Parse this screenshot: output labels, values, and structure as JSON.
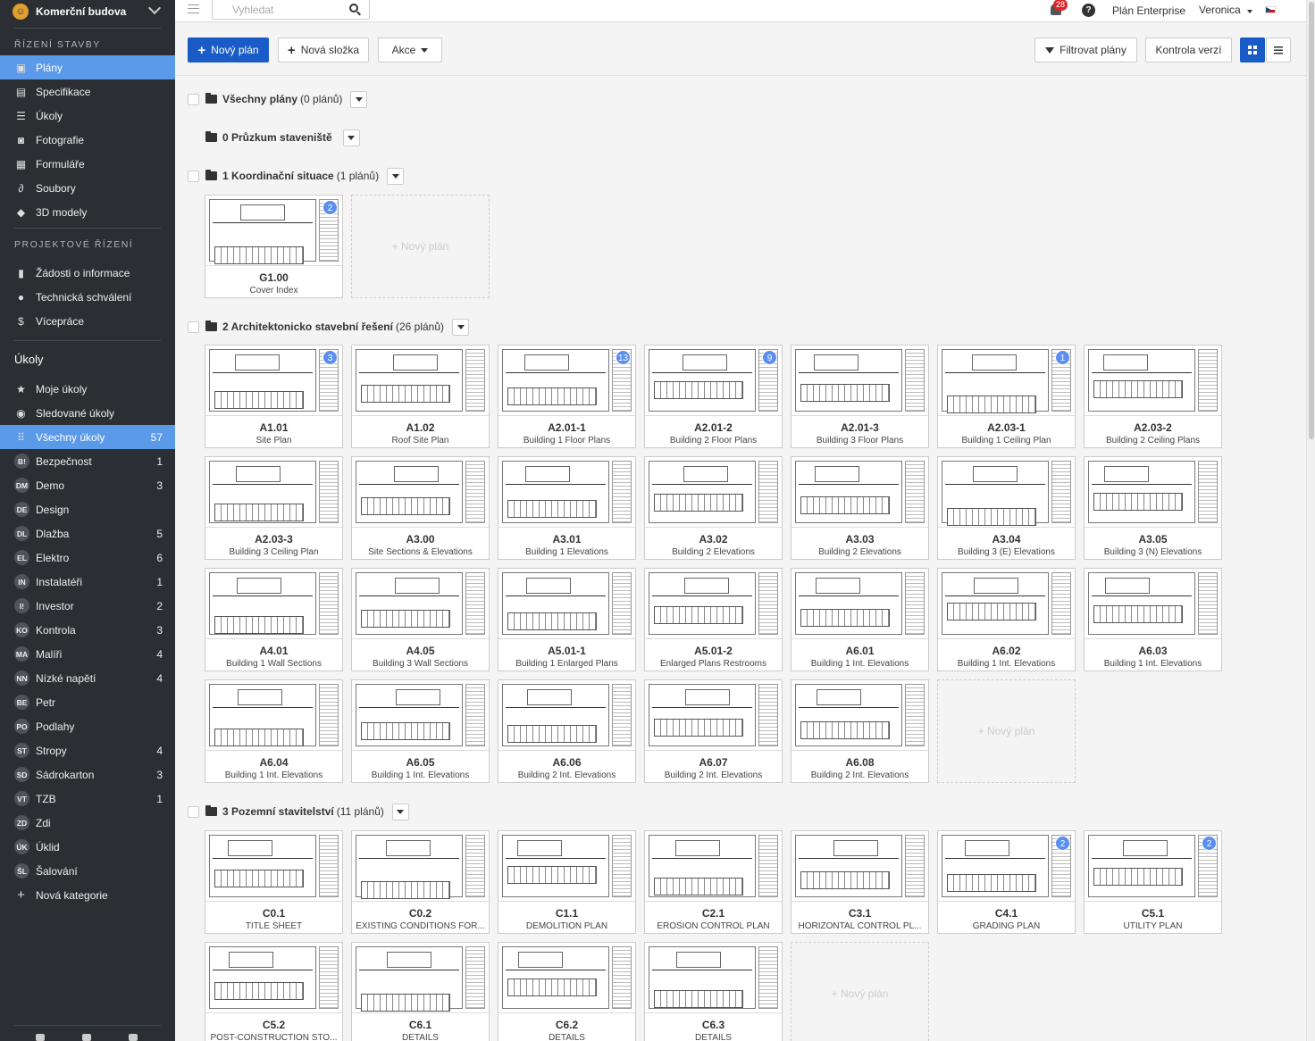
{
  "sidebar": {
    "project": "Komerční budova",
    "section1": "ŘÍZENÍ STAVBY",
    "nav1": [
      {
        "label": "Plány",
        "icon": "plans-icon"
      },
      {
        "label": "Specifikace",
        "icon": "spec-icon"
      },
      {
        "label": "Úkoly",
        "icon": "tasks-icon"
      },
      {
        "label": "Fotografie",
        "icon": "camera-icon"
      },
      {
        "label": "Formuláře",
        "icon": "forms-icon"
      },
      {
        "label": "Soubory",
        "icon": "paperclip-icon"
      },
      {
        "label": "3D modely",
        "icon": "cube-icon"
      }
    ],
    "section2": "PROJEKTOVÉ ŘÍZENÍ",
    "nav2": [
      {
        "label": "Žádosti o informace",
        "icon": "rfi-icon"
      },
      {
        "label": "Technická schválení",
        "icon": "person-icon"
      },
      {
        "label": "Vícepráce",
        "icon": "dollar-doc-icon"
      }
    ],
    "tasks_heading": "Úkoly",
    "tasks_nav": [
      {
        "label": "Moje úkoly",
        "icon": "star-icon",
        "count": ""
      },
      {
        "label": "Sledované úkoly",
        "icon": "eye-icon",
        "count": ""
      },
      {
        "label": "Všechny úkoly",
        "icon": "grid-icon",
        "count": "57"
      }
    ],
    "categories": [
      {
        "abbr": "B!",
        "label": "Bezpečnost",
        "count": "1"
      },
      {
        "abbr": "DM",
        "label": "Demo",
        "count": "3"
      },
      {
        "abbr": "DE",
        "label": "Design",
        "count": ""
      },
      {
        "abbr": "DL",
        "label": "Dlažba",
        "count": "5"
      },
      {
        "abbr": "EL",
        "label": "Elektro",
        "count": "6"
      },
      {
        "abbr": "IN",
        "label": "Instalatéři",
        "count": "1"
      },
      {
        "abbr": "I!",
        "label": "Investor",
        "count": "2"
      },
      {
        "abbr": "KO",
        "label": "Kontrola",
        "count": "3"
      },
      {
        "abbr": "MA",
        "label": "Malíři",
        "count": "4"
      },
      {
        "abbr": "NN",
        "label": "Nízké napětí",
        "count": "4"
      },
      {
        "abbr": "BE",
        "label": "Petr",
        "count": ""
      },
      {
        "abbr": "PO",
        "label": "Podlahy",
        "count": ""
      },
      {
        "abbr": "ST",
        "label": "Stropy",
        "count": "4"
      },
      {
        "abbr": "SD",
        "label": "Sádrokarton",
        "count": "3"
      },
      {
        "abbr": "VT",
        "label": "TZB",
        "count": "1"
      },
      {
        "abbr": "ZD",
        "label": "Zdi",
        "count": ""
      },
      {
        "abbr": "ÚK",
        "label": "Úklid",
        "count": ""
      },
      {
        "abbr": "ŠL",
        "label": "Šalování",
        "count": ""
      }
    ],
    "new_category": "Nová kategorie"
  },
  "topbar": {
    "search_placeholder": "Vyhledat",
    "notifications": "28",
    "help": "?",
    "plan": "Plán Enterprise",
    "user": "Veronica"
  },
  "toolbar": {
    "new_plan": "Nový plán",
    "new_folder": "Nová složka",
    "actions": "Akce",
    "filter": "Filtrovat plány",
    "versions": "Kontrola verzí"
  },
  "new_plan_placeholder": "+ Nový plán",
  "folders": [
    {
      "name": "Všechny plány",
      "count": "(0 plánů)"
    },
    {
      "name": "0 Průzkum staveniště",
      "count": ""
    },
    {
      "name": "1 Koordinační situace",
      "count": "(1 plánů)"
    },
    {
      "name": "2 Architektonicko stavební řešení",
      "count": "(26 plánů)"
    },
    {
      "name": "3 Pozemní stavitelství",
      "count": "(11 plánů)"
    }
  ],
  "plans_f1": [
    {
      "code": "G1.00",
      "name": "Cover Index",
      "badge": "2"
    }
  ],
  "plans_f2": [
    {
      "code": "A1.01",
      "name": "Site Plan",
      "badge": "3"
    },
    {
      "code": "A1.02",
      "name": "Roof Site Plan",
      "badge": ""
    },
    {
      "code": "A2.01-1",
      "name": "Building 1 Floor Plans",
      "badge": "13"
    },
    {
      "code": "A2.01-2",
      "name": "Building 2 Floor Plans",
      "badge": "9"
    },
    {
      "code": "A2.01-3",
      "name": "Building 3 Floor Plans",
      "badge": ""
    },
    {
      "code": "A2.03-1",
      "name": "Building 1 Ceiling Plan",
      "badge": "1"
    },
    {
      "code": "A2.03-2",
      "name": "Building 2 Ceiling Plans",
      "badge": ""
    },
    {
      "code": "A2.03-3",
      "name": "Building 3 Ceiling Plan",
      "badge": ""
    },
    {
      "code": "A3.00",
      "name": "Site Sections & Elevations",
      "badge": ""
    },
    {
      "code": "A3.01",
      "name": "Building 1 Elevations",
      "badge": ""
    },
    {
      "code": "A3.02",
      "name": "Building 2 Elevations",
      "badge": ""
    },
    {
      "code": "A3.03",
      "name": "Building 2 Elevations",
      "badge": ""
    },
    {
      "code": "A3.04",
      "name": "Building 3 (E) Elevations",
      "badge": ""
    },
    {
      "code": "A3.05",
      "name": "Building 3 (N) Elevations",
      "badge": ""
    },
    {
      "code": "A4.01",
      "name": "Building 1 Wall Sections",
      "badge": ""
    },
    {
      "code": "A4.05",
      "name": "Building 3 Wall Sections",
      "badge": ""
    },
    {
      "code": "A5.01-1",
      "name": "Building 1 Enlarged Plans",
      "badge": ""
    },
    {
      "code": "A5.01-2",
      "name": "Enlarged Plans Restrooms",
      "badge": ""
    },
    {
      "code": "A6.01",
      "name": "Building 1 Int. Elevations",
      "badge": ""
    },
    {
      "code": "A6.02",
      "name": "Building 1 Int. Elevations",
      "badge": ""
    },
    {
      "code": "A6.03",
      "name": "Building 1 Int. Elevations",
      "badge": ""
    },
    {
      "code": "A6.04",
      "name": "Building 1 Int. Elevations",
      "badge": ""
    },
    {
      "code": "A6.05",
      "name": "Building 1 Int. Elevations",
      "badge": ""
    },
    {
      "code": "A6.06",
      "name": "Building 2 Int. Elevations",
      "badge": ""
    },
    {
      "code": "A6.07",
      "name": "Building 2 Int. Elevations",
      "badge": ""
    },
    {
      "code": "A6.08",
      "name": "Building 2 Int. Elevations",
      "badge": ""
    }
  ],
  "plans_f3": [
    {
      "code": "C0.1",
      "name": "TITLE SHEET",
      "badge": ""
    },
    {
      "code": "C0.2",
      "name": "EXISTING CONDITIONS FOR...",
      "badge": ""
    },
    {
      "code": "C1.1",
      "name": "DEMOLITION PLAN",
      "badge": ""
    },
    {
      "code": "C2.1",
      "name": "EROSION CONTROL PLAN",
      "badge": ""
    },
    {
      "code": "C3.1",
      "name": "HORIZONTAL CONTROL PL...",
      "badge": ""
    },
    {
      "code": "C4.1",
      "name": "GRADING PLAN",
      "badge": "2"
    },
    {
      "code": "C5.1",
      "name": "UTILITY PLAN",
      "badge": "2"
    },
    {
      "code": "C5.2",
      "name": "POST-CONSTRUCTION STO...",
      "badge": ""
    },
    {
      "code": "C6.1",
      "name": "DETAILS",
      "badge": ""
    },
    {
      "code": "C6.2",
      "name": "DETAILS",
      "badge": ""
    },
    {
      "code": "C6.3",
      "name": "DETAILS",
      "badge": ""
    }
  ]
}
